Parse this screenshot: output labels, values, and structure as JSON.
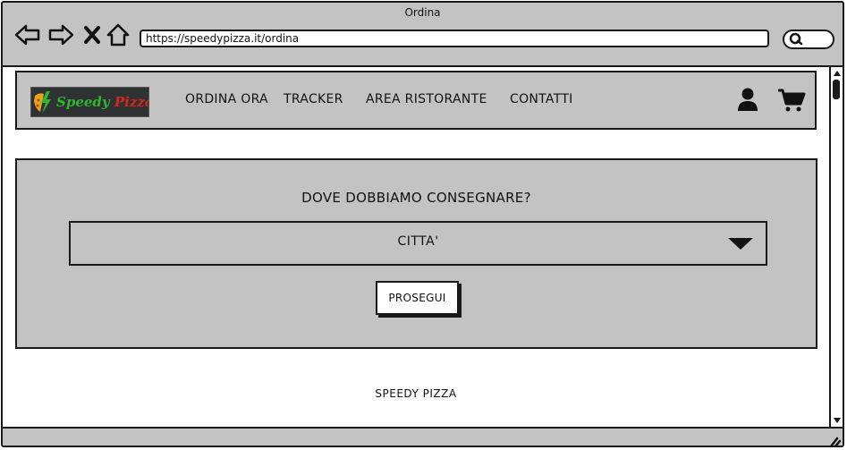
{
  "window": {
    "title": "Ordina",
    "url": "https://speedypizza.it/ordina"
  },
  "icons": {
    "back": "back-arrow-icon",
    "forward": "forward-arrow-icon",
    "stop": "close-icon",
    "home": "home-icon",
    "search": "search-icon",
    "user": "user-icon",
    "cart": "shopping-cart-icon"
  },
  "header": {
    "logo": {
      "text_main": "Speedy ",
      "text_accent": "Pizza",
      "colors": {
        "main": "#2fb52f",
        "accent": "#d8261c",
        "background": "#2f3232"
      }
    },
    "nav": [
      {
        "label": "ORDINA ORA"
      },
      {
        "label": "TRACKER"
      },
      {
        "label": "AREA RISTORANTE"
      },
      {
        "label": "CONTATTI"
      }
    ]
  },
  "delivery": {
    "title": "DOVE DOBBIAMO CONSEGNARE?",
    "city_select": {
      "selected": "CITTA'"
    },
    "proceed_label": "PROSEGUI"
  },
  "footer": {
    "text": "SPEEDY PIZZA"
  },
  "theme": {
    "panel_bg": "#c3c3c3",
    "border": "#1a1a1a",
    "page_bg": "#ffffff"
  }
}
